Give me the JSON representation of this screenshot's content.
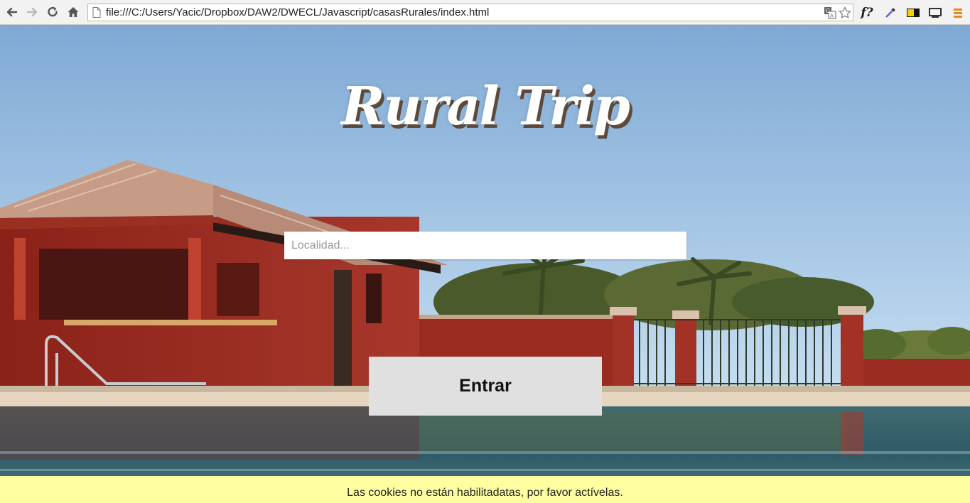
{
  "browser": {
    "url": "file:///C:/Users/Yacic/Dropbox/DAW2/DWECL/Javascript/casasRurales/index.html",
    "extensions": [
      "fontface-ninja",
      "color-picker-icon",
      "contrast-icon",
      "cast-icon",
      "menu-icon"
    ],
    "fonts_ext_label": "f?"
  },
  "page": {
    "title": "Rural Trip",
    "search": {
      "placeholder": "Localidad...",
      "value": ""
    },
    "enter_label": "Entrar",
    "cookie_message": "Las cookies no están habilitadatas, por favor actívelas."
  },
  "colors": {
    "cookie_banner": "#fffea0",
    "button_bg": "#e0e0e0",
    "title_shadow": "#5d4a3a"
  }
}
